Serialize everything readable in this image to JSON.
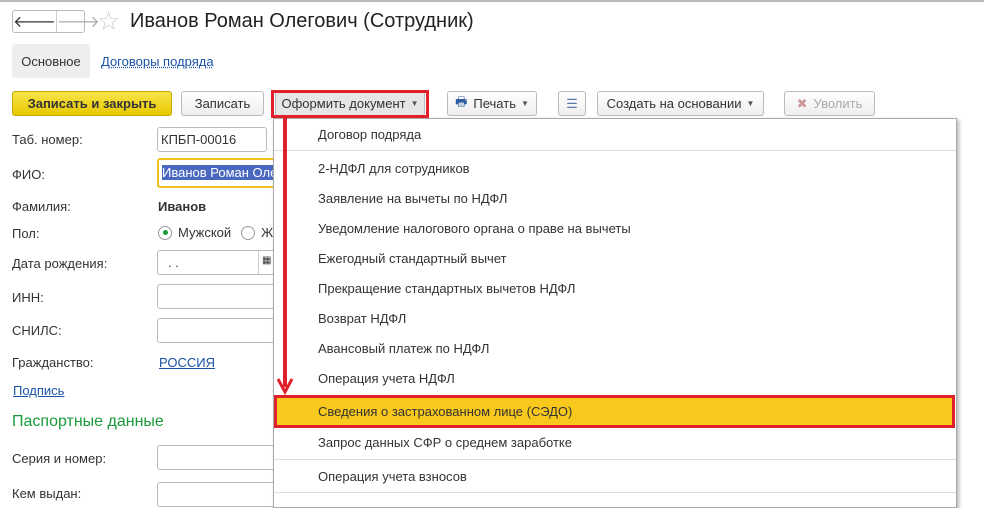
{
  "window": {
    "title": "Иванов Роман Олегович (Сотрудник)",
    "back": "🡐",
    "forward": "🡒",
    "favorite": "☆"
  },
  "tabs": [
    {
      "label": "Основное"
    },
    {
      "label": "Договоры подряда"
    }
  ],
  "toolbar": {
    "save_close": "Записать и закрыть",
    "save": "Записать",
    "create_doc": "Оформить документ",
    "print": "Печать",
    "create_based": "Создать на основании",
    "dismiss": "Уволить"
  },
  "form": {
    "tab_number_label": "Таб. номер:",
    "tab_number": "КПБП-00016",
    "fio_label": "ФИО:",
    "fio": "Иванов Роман Оле",
    "surname_label": "Фамилия:",
    "surname": "Иванов",
    "gender_label": "Пол:",
    "gender_male": "Мужской",
    "gender_female": "Ж",
    "birth_label": "Дата рождения:",
    "birth": " .  .",
    "inn_label": "ИНН:",
    "snils_label": "СНИЛС:",
    "citizenship_label": "Гражданство:",
    "citizenship": "РОССИЯ",
    "signature": "Подпись",
    "passport_header": "Паспортные данные",
    "series_label": "Серия и номер:",
    "issued_label": "Кем выдан:"
  },
  "menu": {
    "items": [
      "Договор подряда",
      "2-НДФЛ для сотрудников",
      "Заявление на вычеты по НДФЛ",
      "Уведомление налогового органа о праве на вычеты",
      "Ежегодный стандартный вычет",
      "Прекращение стандартных вычетов НДФЛ",
      "Возврат НДФЛ",
      "Авансовый платеж по НДФЛ",
      "Операция учета НДФЛ",
      "Сведения о застрахованном лице (СЭДО)",
      "Запрос данных СФР о среднем заработке",
      "Операция учета взносов"
    ],
    "highlighted": 9
  },
  "colors": {
    "accent": "#f8c81c",
    "annotation": "#e0202a",
    "link": "#1a52a8",
    "section": "#1a9a3a"
  }
}
